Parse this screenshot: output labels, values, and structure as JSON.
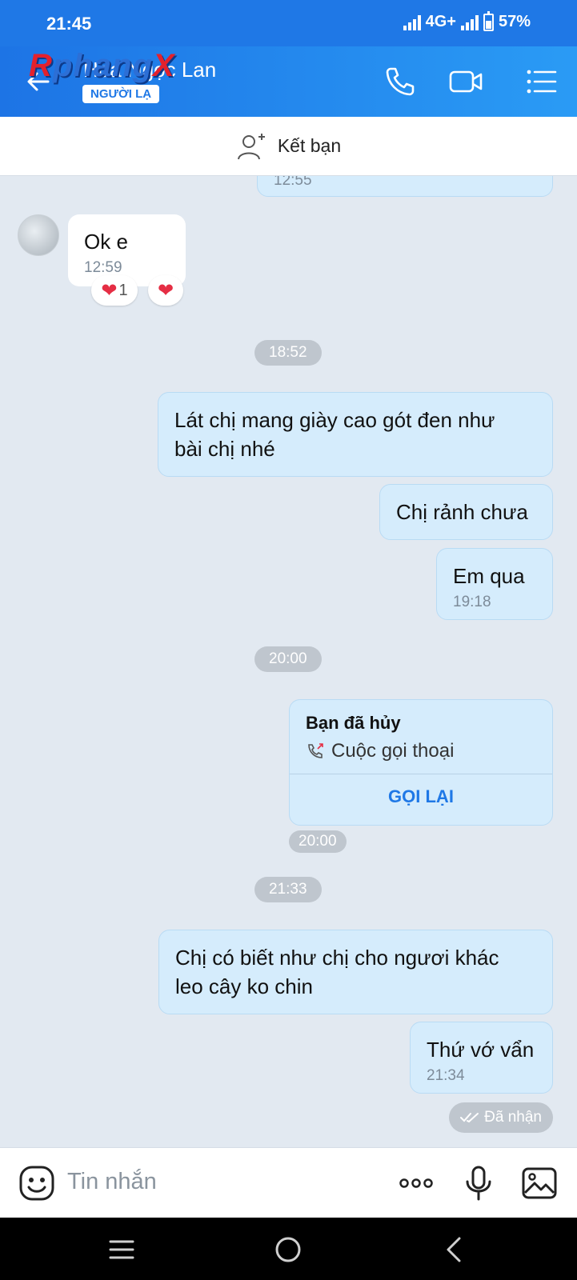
{
  "status_bar": {
    "time": "21:45",
    "network": "4G+",
    "battery": "57%"
  },
  "header": {
    "contact_name": "Hoa Ngọc Lan",
    "badge": "NGƯỜI LẠ",
    "watermark": {
      "part1": "R",
      "part2": "phang",
      "part3": "X"
    }
  },
  "add_friend": {
    "label": "Kết bạn"
  },
  "messages": {
    "m0": {
      "time": "12:55"
    },
    "m1": {
      "text": "Ok e",
      "time": "12:59",
      "reaction_count": "1"
    },
    "sep1": "18:52",
    "m2": {
      "line1": "Lát chị mang giày cao gót đen như",
      "line2": "bài chị nhé"
    },
    "m3": {
      "text": "Chị rảnh chưa"
    },
    "m4": {
      "text": "Em qua",
      "time": "19:18"
    },
    "sep2": "20:00",
    "call": {
      "title": "Bạn đã hủy",
      "subtitle": "Cuộc gọi thoại",
      "action": "GỌI LẠI",
      "time": "20:00"
    },
    "sep3": "21:33",
    "m5": {
      "line1": "Chị có biết như chị cho ngươi khác",
      "line2": "leo cây ko chin"
    },
    "m6": {
      "text": "Thứ vớ vẩn",
      "time": "21:34"
    },
    "status": "Đã nhận"
  },
  "input": {
    "placeholder": "Tin nhắn"
  },
  "colors": {
    "accent": "#1f78e6",
    "bubble_mine": "#d5ecfc",
    "background": "#e2e9f1",
    "heart": "#e52e44"
  }
}
